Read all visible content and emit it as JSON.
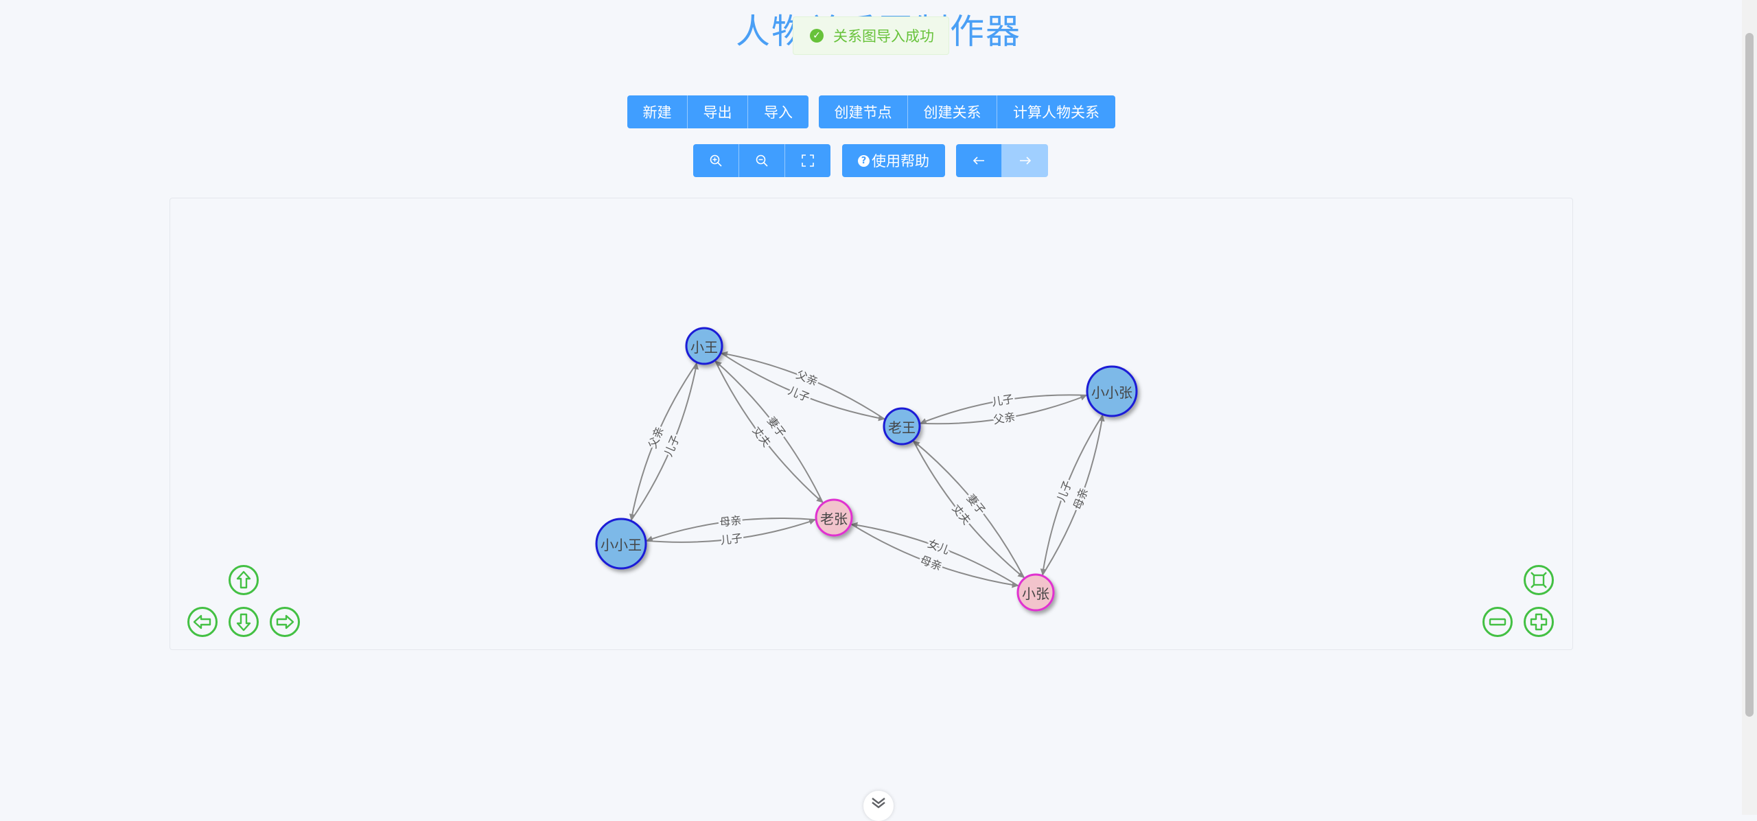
{
  "header": {
    "title": "人物关系图制作器"
  },
  "toast": {
    "message": "关系图导入成功",
    "icon": "check-circle-icon"
  },
  "toolbar": {
    "file_group": [
      "新建",
      "导出",
      "导入"
    ],
    "edit_group": [
      "创建节点",
      "创建关系",
      "计算人物关系"
    ],
    "zoom_group": {
      "zoom_in_icon": "zoom-in-icon",
      "zoom_out_icon": "zoom-out-icon",
      "fullscreen_icon": "fullscreen-icon"
    },
    "help_label": "使用帮助",
    "history": {
      "back_icon": "arrow-left-icon",
      "forward_icon": "arrow-right-icon",
      "forward_disabled": true
    }
  },
  "graph": {
    "nodes": [
      {
        "id": "xw",
        "label": "小王",
        "gender": "male"
      },
      {
        "id": "lw",
        "label": "老王",
        "gender": "male"
      },
      {
        "id": "xxz",
        "label": "小小张",
        "gender": "male"
      },
      {
        "id": "xxw",
        "label": "小小王",
        "gender": "male"
      },
      {
        "id": "lz",
        "label": "老张",
        "gender": "female"
      },
      {
        "id": "xz",
        "label": "小张",
        "gender": "female"
      }
    ],
    "edges": [
      {
        "from": "lw",
        "to": "xw",
        "label": "父亲"
      },
      {
        "from": "xw",
        "to": "lw",
        "label": "儿子"
      },
      {
        "from": "lw",
        "to": "xxz",
        "label": "父亲"
      },
      {
        "from": "xxz",
        "to": "lw",
        "label": "儿子"
      },
      {
        "from": "xw",
        "to": "xxw",
        "label": "父亲"
      },
      {
        "from": "xxw",
        "to": "xw",
        "label": "儿子"
      },
      {
        "from": "lz",
        "to": "xw",
        "label": "妻子"
      },
      {
        "from": "xw",
        "to": "lz",
        "label": "丈夫"
      },
      {
        "from": "xxw",
        "to": "lz",
        "label": "儿子"
      },
      {
        "from": "lz",
        "to": "xxw",
        "label": "母亲"
      },
      {
        "from": "xz",
        "to": "lw",
        "label": "妻子"
      },
      {
        "from": "lw",
        "to": "xz",
        "label": "丈夫"
      },
      {
        "from": "xxz",
        "to": "xz",
        "label": "儿子"
      },
      {
        "from": "xz",
        "to": "xxz",
        "label": "母亲"
      },
      {
        "from": "xz",
        "to": "lz",
        "label": "女儿"
      },
      {
        "from": "lz",
        "to": "xz",
        "label": "母亲"
      }
    ],
    "colors": {
      "male_fill": "#7db9e8",
      "male_stroke": "#1a1ad6",
      "female_fill": "#f2c4cc",
      "female_stroke": "#e030d0",
      "edge": "#8a8a8a"
    }
  },
  "pan_controls": {
    "up": "arrow-up-icon",
    "left": "arrow-left-icon",
    "down": "arrow-down-icon",
    "right": "arrow-right-icon"
  },
  "zoom_controls": {
    "fit": "fit-view-icon",
    "zoom_out": "minus-icon",
    "zoom_in": "plus-icon"
  },
  "colors": {
    "primary": "#409eff",
    "success": "#67c23a",
    "control": "#43c043"
  }
}
